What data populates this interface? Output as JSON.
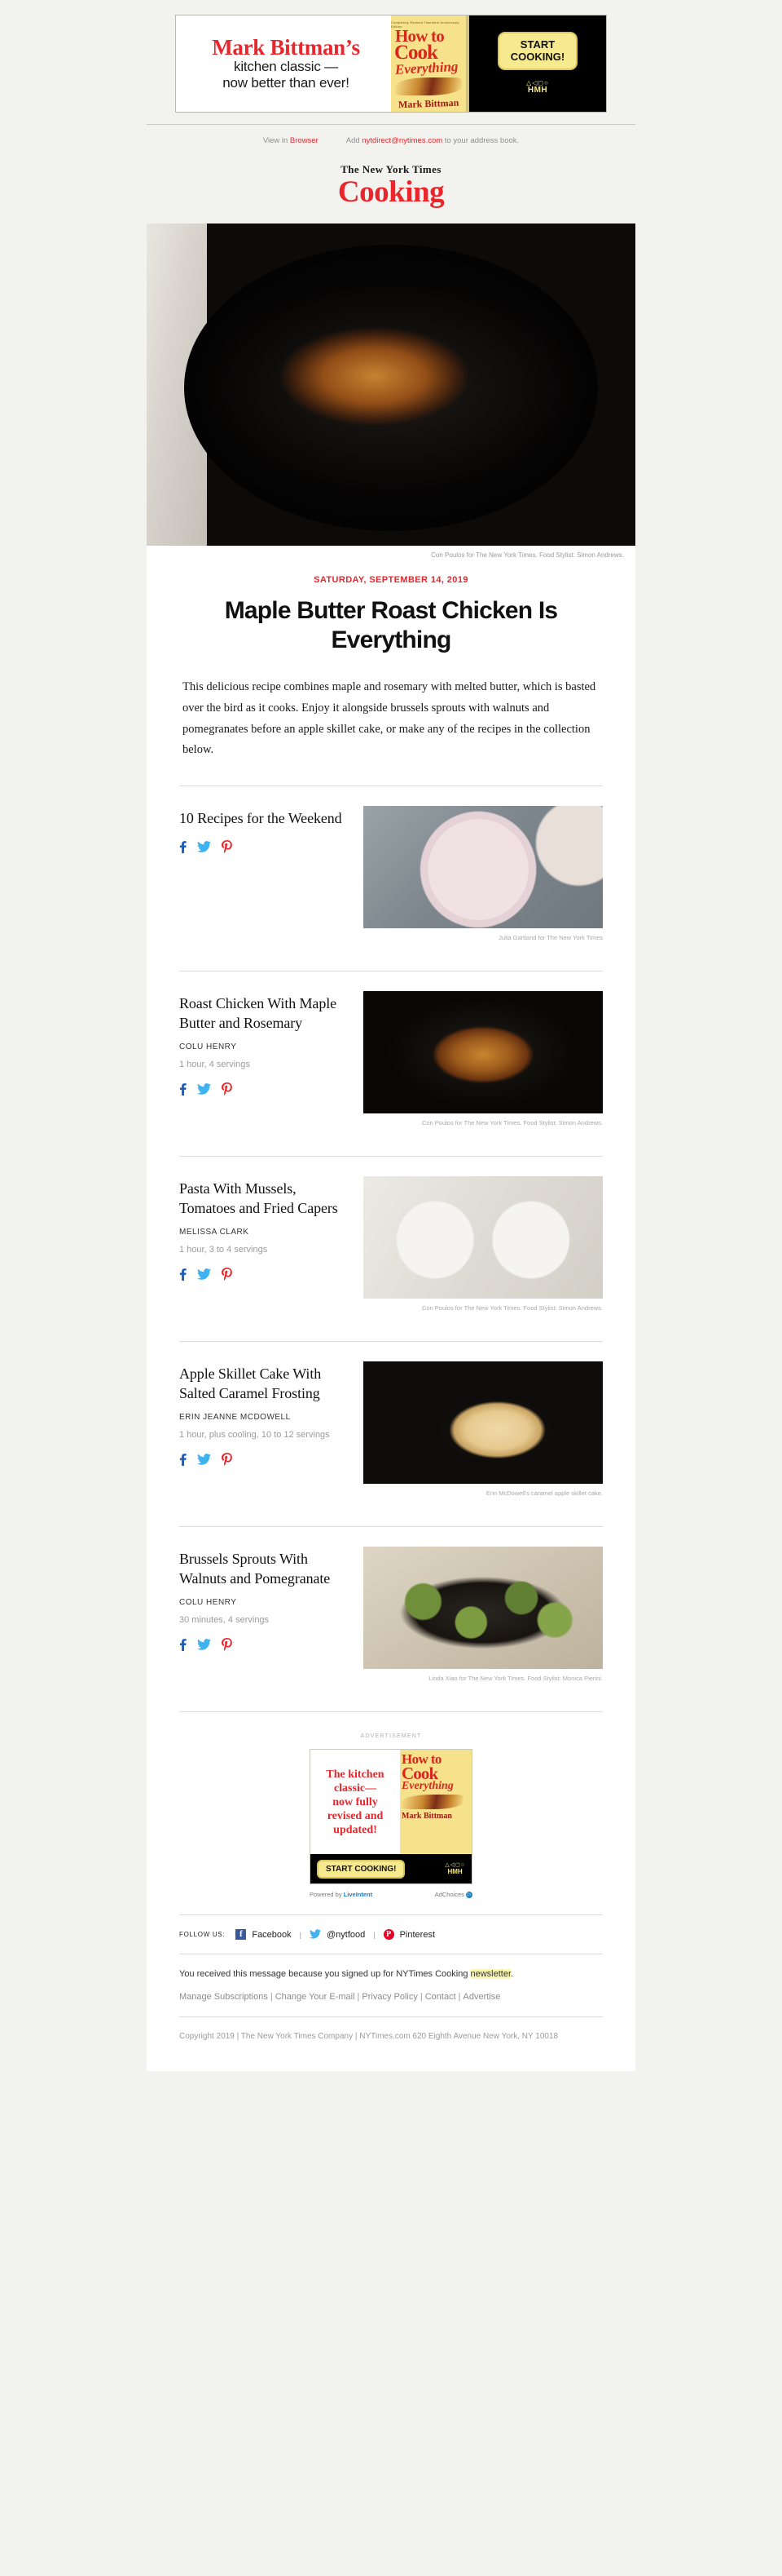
{
  "top_ad": {
    "line1": "Mark Bittman’s",
    "line2": "kitchen classic —",
    "line3": "now better than ever!",
    "book": {
      "top_strap": "Completely Revised Twentieth Anniversary Edition",
      "how": "How to",
      "cook": "Cook",
      "everything": "Everything",
      "author": "Mark Bittman"
    },
    "cta_line1": "START",
    "cta_line2": "COOKING!",
    "publisher_glyph": "△◁◻○",
    "publisher": "HMH"
  },
  "preheader": {
    "view_prefix": "View in ",
    "view_link": "Browser",
    "add_prefix": "Add ",
    "add_email": "nytdirect@nytimes.com",
    "add_suffix": " to your address book."
  },
  "masthead": {
    "nyt": "The New York Times",
    "cooking": "Cooking"
  },
  "hero": {
    "credit": "Con Poulos for The New York Times. Food Stylist: Simon Andrews."
  },
  "article": {
    "kicker": "SATURDAY, SEPTEMBER 14, 2019",
    "headline": "Maple Butter Roast Chicken Is Everything",
    "dek": "This delicious recipe combines maple and rosemary with melted butter, which is basted over the bird as it cooks. Enjoy it alongside brussels sprouts with walnuts and pomegranates before an apple skillet cake, or make any of the recipes in the collection below."
  },
  "recipes": [
    {
      "title": "10 Recipes for the Weekend",
      "author": "",
      "meta": "",
      "credit": "Julia Gartland for The New York Times",
      "photo_class": "ph-chili"
    },
    {
      "title": "Roast Chicken With Maple Butter and Rosemary",
      "author": "COLU HENRY",
      "meta": "1 hour, 4 servings",
      "credit": "Con Poulos for The New York Times. Food Stylist: Simon Andrews.",
      "photo_class": "ph-chicken"
    },
    {
      "title": "Pasta With Mussels, Tomatoes and Fried Capers",
      "author": "MELISSA CLARK",
      "meta": "1 hour, 3 to 4 servings",
      "credit": "Con Poulos for The New York Times. Food Stylist: Simon Andrews.",
      "photo_class": "ph-pasta"
    },
    {
      "title": "Apple Skillet Cake With Salted Caramel Frosting",
      "author": "ERIN JEANNE MCDOWELL",
      "meta": "1 hour, plus cooling, 10 to 12 servings",
      "credit": "Erin McDowell's caramel apple skillet cake.",
      "photo_class": "ph-cake"
    },
    {
      "title": "Brussels Sprouts With Walnuts and Pomegranate",
      "author": "COLU HENRY",
      "meta": "30 minutes, 4 servings",
      "credit": "Linda Xiao for The New York Times. Food Stylist: Monica Pierini.",
      "photo_class": "ph-sprouts"
    }
  ],
  "share_icons": {
    "facebook": "facebook-icon",
    "twitter": "twitter-icon",
    "pinterest": "pinterest-icon"
  },
  "bottom_ad": {
    "label": "ADVERTISEMENT",
    "copy_line1": "The kitchen",
    "copy_line2": "classic—",
    "copy_line3": "now fully",
    "copy_line4": "revised and",
    "copy_line5": "updated!",
    "book": {
      "how": "How to",
      "cook": "Cook",
      "everything": "Everything",
      "author": "Mark Bittman"
    },
    "cta": "START COOKING!",
    "publisher_glyph": "△◁◻○",
    "publisher": "HMH",
    "powered_by": "Powered by",
    "powered_brand": "LiveIntent",
    "adchoices": "AdChoices"
  },
  "footer": {
    "follow_label": "FOLLOW US:",
    "facebook": "Facebook",
    "twitter": "@nytfood",
    "pinterest": "Pinterest",
    "legal_prefix": "You received this message because you signed up for NYTimes Cooking ",
    "legal_highlight": "newsletter",
    "legal_suffix": ".",
    "links": [
      "Manage Subscriptions",
      "Change Your E-mail",
      "Privacy Policy",
      "Contact",
      "Advertise"
    ],
    "copyright": "Copyright 2019  |  The New York Times Company  |  NYTimes.com 620 Eighth Avenue New York, NY 10018"
  }
}
